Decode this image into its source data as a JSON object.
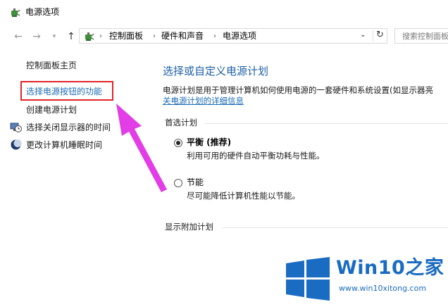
{
  "window": {
    "title": "电源选项",
    "icon": "power-options-icon"
  },
  "address_bar": {
    "breadcrumbs": [
      "控制面板",
      "硬件和声音",
      "电源选项"
    ],
    "search_placeholder": "搜索控制面板"
  },
  "left_nav": {
    "home": "控制面板主页",
    "items": [
      {
        "label": "选择电源按钮的功能",
        "highlighted": true
      },
      {
        "label": "创建电源计划"
      },
      {
        "label": "选择关闭显示器的时间",
        "icon": "display-clock-icon"
      },
      {
        "label": "更改计算机睡眠时间",
        "icon": "moon-icon"
      }
    ]
  },
  "main": {
    "heading": "选择或自定义电源计划",
    "description": "电源计划是用于管理计算机如何使用电源的一套硬件和系统设置(如显示器亮",
    "details_link": "关电源计划的详细信息",
    "preferred_label": "首选计划",
    "plans": [
      {
        "name": "平衡 (推荐)",
        "description": "利用可用的硬件自动平衡功耗与性能。",
        "selected": true
      },
      {
        "name": "节能",
        "description": "尽可能降低计算机性能以节能。",
        "selected": false
      }
    ],
    "additional_label": "显示附加计划"
  },
  "watermark": {
    "brand": "Win10之家",
    "url": "www.win10xitong.com"
  },
  "colors": {
    "link": "#1a6ab5",
    "heading": "#1c5fa8",
    "highlight_box": "#e0242b",
    "arrow": "#e23de6",
    "watermark": "#1a6bc2"
  }
}
